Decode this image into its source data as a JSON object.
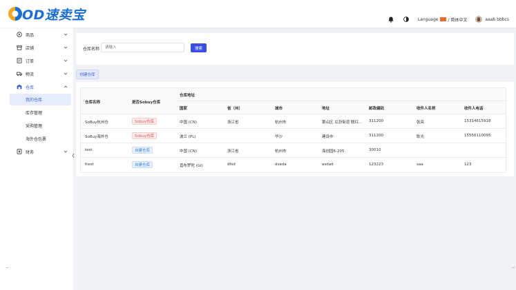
{
  "header": {
    "logo_text": "OD速卖宝",
    "language_label": "Language",
    "language_value": "/ 简体中文",
    "username": "aaab bbbcs",
    "icons": [
      "notification-icon",
      "theme-toggle-icon"
    ]
  },
  "sidebar": {
    "items": [
      {
        "label": "商品",
        "icon": "product-icon",
        "expanded": false
      },
      {
        "label": "店铺",
        "icon": "store-icon",
        "expanded": false
      },
      {
        "label": "订单",
        "icon": "order-icon",
        "expanded": false
      },
      {
        "label": "物流",
        "icon": "truck-icon",
        "expanded": false
      },
      {
        "label": "仓库",
        "icon": "warehouse-icon",
        "expanded": true
      },
      {
        "label": "财务",
        "icon": "finance-icon",
        "expanded": false
      }
    ],
    "warehouse_sub": [
      {
        "label": "我的仓库",
        "active": true
      },
      {
        "label": "库存管理",
        "active": false
      },
      {
        "label": "采购管理",
        "active": false
      },
      {
        "label": "海外仓包裹",
        "active": false
      }
    ]
  },
  "search": {
    "label": "仓库名称",
    "placeholder": "请输入",
    "button": "搜索"
  },
  "create_button": "创建仓库",
  "table": {
    "headers": {
      "name": "仓库名称",
      "is_sobuy": "是否Sobuy仓库",
      "address_group": "仓库地址",
      "country": "国家",
      "province": "省（州）",
      "city": "城市",
      "address": "地址",
      "postcode": "邮政编码",
      "receiver": "收件人名称",
      "phone": "收件人电话"
    },
    "rows": [
      {
        "name": "SoBuy杭州仓",
        "tag": "Sobuy仓库",
        "tag_type": "red",
        "country": "中国 (CN)",
        "province": "浙江省",
        "city": "杭州市",
        "address": "萧山区 瓜沥街道 联红...",
        "postcode": "311200",
        "receiver": "张亮",
        "phone": "15314615918"
      },
      {
        "name": "SoBuy海外仓",
        "tag": "Sobuy仓库",
        "tag_type": "red",
        "country": "波兰 (PL)",
        "province": "",
        "city": "华沙",
        "address": "建设中",
        "postcode": "311200",
        "receiver": "耿光",
        "phone": "15556110095"
      },
      {
        "name": "test",
        "tag": "自建仓库",
        "tag_type": "blue",
        "country": "中国 (CN)",
        "province": "浙江省",
        "city": "杭州市",
        "address": "海创园6-205",
        "postcode": "30010",
        "receiver": "",
        "phone": ""
      },
      {
        "name": "ttest",
        "tag": "自建仓库",
        "tag_type": "blue",
        "country": "直布罗陀 (GI)",
        "province": "dfsd",
        "city": "dsada",
        "address": "asdad",
        "postcode": "123223",
        "receiver": "saa",
        "phone": "123"
      }
    ]
  },
  "colors": {
    "accent": "#3a4fe0",
    "logo_blue": "#1a6fd0",
    "logo_orange": "#f5a623",
    "tag_red": "#e0554f",
    "tag_blue": "#3a86e0"
  }
}
